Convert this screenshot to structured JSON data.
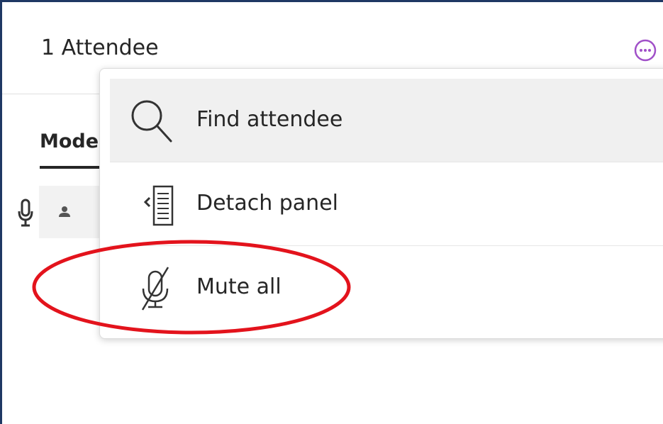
{
  "panel": {
    "title": "1 Attendee",
    "tab_label": "Mode"
  },
  "menu": {
    "items": [
      {
        "label": "Find attendee",
        "icon": "search-icon"
      },
      {
        "label": "Detach panel",
        "icon": "detach-panel-icon"
      },
      {
        "label": "Mute all",
        "icon": "microphone-muted-icon"
      }
    ]
  },
  "colors": {
    "frame_border": "#1f3864",
    "more_button_accent": "#a050c8",
    "annotation_circle": "#e3131c",
    "menu_hover": "#f0f0f0"
  }
}
